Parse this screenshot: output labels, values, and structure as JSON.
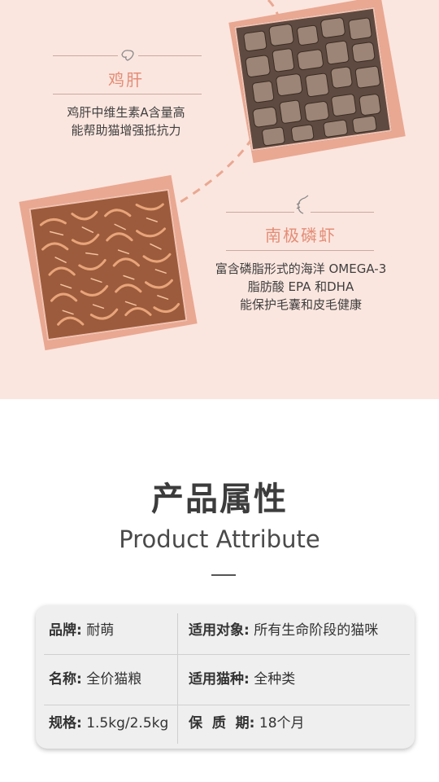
{
  "features": [
    {
      "title": "鸡肝",
      "desc_lines": [
        "鸡肝中维生素A含量高",
        "能帮助猫增强抵抗力"
      ],
      "icon": "liver-icon"
    },
    {
      "title": "南极磷虾",
      "desc_lines": [
        "富含磷脂形式的海洋 OMEGA-3",
        "脂肪酸 EPA 和DHA",
        "能保护毛囊和皮毛健康"
      ],
      "icon": "shrimp-icon"
    }
  ],
  "section": {
    "title": "产品属性",
    "subtitle": "Product Attribute"
  },
  "attributes": [
    {
      "left_key": "品牌:",
      "left_val": " 耐萌",
      "right_key": "适用对象:",
      "right_val": " 所有生命阶段的猫咪"
    },
    {
      "left_key": "名称:",
      "left_val": " 全价猫粮",
      "right_key": "适用猫种:",
      "right_val": " 全种类"
    },
    {
      "left_key": "规格:",
      "left_val": " 1.5kg/2.5kg",
      "right_key": "保  质  期:",
      "right_val": " 18个月"
    }
  ],
  "colors": {
    "hero_bg": "#fbe6df",
    "accent": "#e38d77",
    "photo_back": "#e9a892"
  }
}
